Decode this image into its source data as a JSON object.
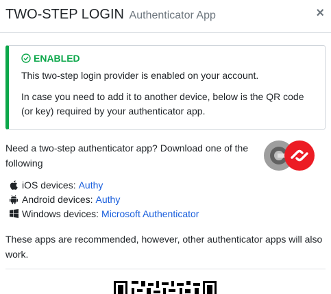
{
  "header": {
    "title": "TWO-STEP LOGIN",
    "subtitle": "Authenticator App",
    "close_symbol": "×"
  },
  "alert": {
    "status": "ENABLED",
    "status_icon": "check-circle-icon",
    "line1": "This two-step login provider is enabled on your account.",
    "line2": "In case you need to add it to another device, below is the QR code (or key) required by your authenticator app.",
    "accent_color": "#0ca74a"
  },
  "intro": "Need a two-step authenticator app? Download one of the following",
  "devices": [
    {
      "label": "iOS devices:",
      "app": "Authy",
      "icon": "apple-icon"
    },
    {
      "label": "Android devices:",
      "app": "Authy",
      "icon": "android-icon"
    },
    {
      "label": "Windows devices:",
      "app": "Microsoft Authenticator",
      "icon": "windows-icon"
    }
  ],
  "recommended": "These apps are recommended, however, other authenticator apps will also work.",
  "link_color": "#175ddc"
}
